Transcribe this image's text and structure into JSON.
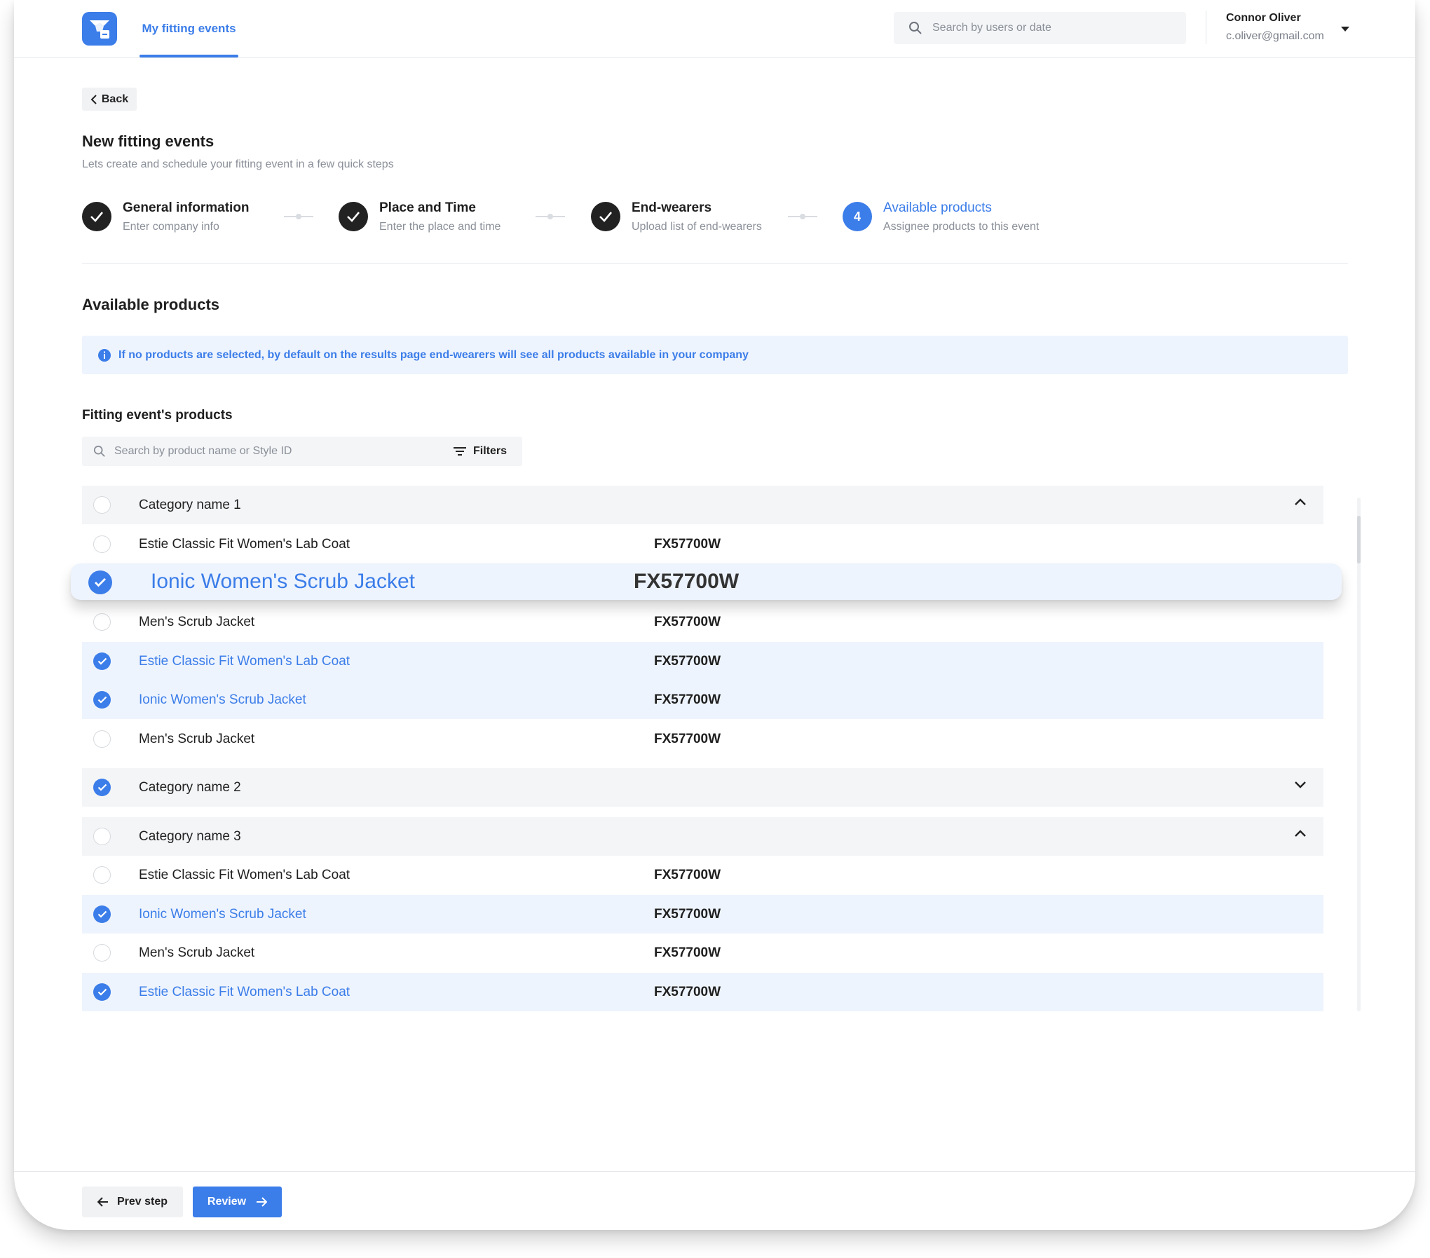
{
  "nav": {
    "active_tab": "My fitting events",
    "search_placeholder": "Search by users or date",
    "user_name": "Connor Oliver",
    "user_email": "c.oliver@gmail.com"
  },
  "back_label": "Back",
  "page": {
    "title": "New fitting events",
    "subtitle": "Lets create and schedule your fitting event in a few quick steps"
  },
  "steps": [
    {
      "title": "General information",
      "subtitle": "Enter company info",
      "status": "done"
    },
    {
      "title": "Place and Time",
      "subtitle": "Enter the place and time",
      "status": "done"
    },
    {
      "title": "End-wearers",
      "subtitle": "Upload list of end-wearers",
      "status": "done"
    },
    {
      "number": "4",
      "title": "Available products",
      "subtitle": "Assignee products to this event",
      "status": "current"
    }
  ],
  "section_title": "Available products",
  "info_message": "If no products are selected, by default on the results page end-wearers will see all products available in your company",
  "products_title": "Fitting event's products",
  "product_search_placeholder": "Search by product name or Style ID",
  "filters_label": "Filters",
  "categories": [
    {
      "name": "Category name 1",
      "selected": false,
      "expanded": true,
      "products": [
        {
          "name": "Estie Classic Fit Women's Lab Coat",
          "style_id": "FX57700W",
          "selected": false
        },
        {
          "name": "Ionic Women's Scrub Jacket",
          "style_id": "FX57700W",
          "selected": true,
          "highlighted": true
        },
        {
          "name": "Men's Scrub Jacket",
          "style_id": "FX57700W",
          "selected": false
        },
        {
          "name": "Estie Classic Fit Women's Lab Coat",
          "style_id": "FX57700W",
          "selected": true
        },
        {
          "name": "Ionic Women's Scrub Jacket",
          "style_id": "FX57700W",
          "selected": true
        },
        {
          "name": "Men's Scrub Jacket",
          "style_id": "FX57700W",
          "selected": false
        }
      ]
    },
    {
      "name": "Category name 2",
      "selected": true,
      "expanded": false,
      "products": []
    },
    {
      "name": "Category name 3",
      "selected": false,
      "expanded": true,
      "products": [
        {
          "name": "Estie Classic Fit Women's Lab Coat",
          "style_id": "FX57700W",
          "selected": false
        },
        {
          "name": "Ionic Women's Scrub Jacket",
          "style_id": "FX57700W",
          "selected": true
        },
        {
          "name": "Men's Scrub Jacket",
          "style_id": "FX57700W",
          "selected": false
        },
        {
          "name": "Estie Classic Fit Women's Lab Coat",
          "style_id": "FX57700W",
          "selected": true
        }
      ]
    }
  ],
  "footer": {
    "prev_label": "Prev step",
    "review_label": "Review"
  },
  "colors": {
    "accent": "#3b7de9",
    "selected_row": "#eef4fd",
    "category_row": "#f4f5f7"
  }
}
